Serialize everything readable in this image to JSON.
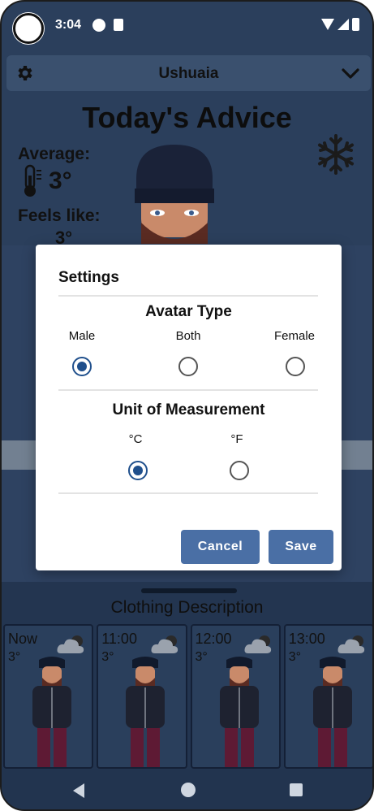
{
  "status_bar": {
    "time": "3:04"
  },
  "header": {
    "location": "Ushuaia"
  },
  "advice": {
    "title": "Today's Advice",
    "average_label": "Average:",
    "average_value": "3°",
    "feels_like_label": "Feels like:",
    "feels_like_value": "3°"
  },
  "settings_dialog": {
    "title": "Settings",
    "avatar_section": {
      "title": "Avatar Type",
      "options": [
        "Male",
        "Both",
        "Female"
      ],
      "selected": "Male"
    },
    "unit_section": {
      "title": "Unit of Measurement",
      "options": [
        "°C",
        "°F"
      ],
      "selected": "°C"
    },
    "cancel_label": "Cancel",
    "save_label": "Save"
  },
  "clothing": {
    "title": "Clothing Description",
    "forecast": [
      {
        "time": "Now",
        "temp": "3°"
      },
      {
        "time": "11:00",
        "temp": "3°"
      },
      {
        "time": "12:00",
        "temp": "3°"
      },
      {
        "time": "13:00",
        "temp": "3°"
      }
    ]
  },
  "colors": {
    "background": "#2b3f5c",
    "accent_button": "#4a6fa5",
    "radio_selected": "#1f4f8c"
  },
  "icons": [
    "gear-icon",
    "chevron-down-icon",
    "thermometer-icon",
    "snowflake-icon",
    "cloud-icon"
  ]
}
